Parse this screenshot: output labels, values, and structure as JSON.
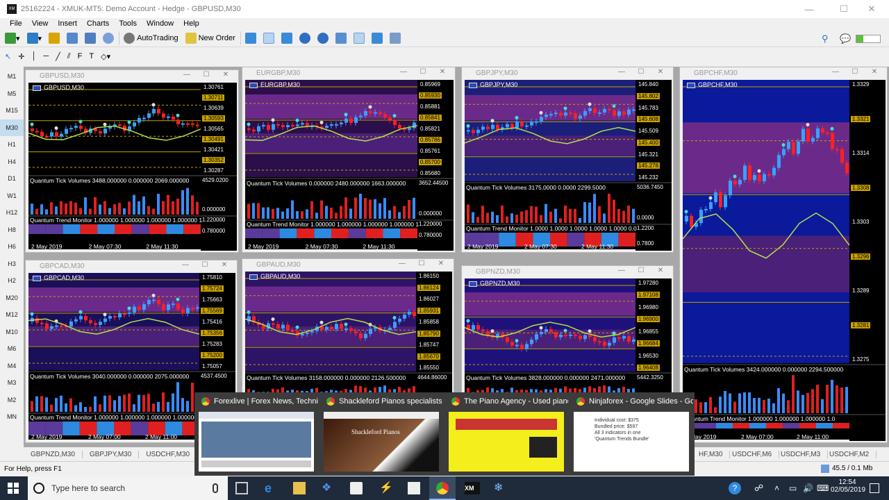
{
  "window": {
    "title": "25162224 - XMUK-MT5: Demo Account - Hedge - GBPUSD,M30",
    "minimize": "—",
    "maximize": "☐",
    "close": "✕"
  },
  "menu": [
    "File",
    "View",
    "Insert",
    "Charts",
    "Tools",
    "Window",
    "Help"
  ],
  "toolbar": {
    "autotrading": "AutoTrading",
    "new_order": "New Order"
  },
  "timeframes": [
    "M1",
    "M5",
    "M15",
    "M30",
    "H1",
    "H4",
    "D1",
    "W1",
    "H12",
    "H8",
    "H6",
    "H3",
    "H2",
    "M20",
    "M12",
    "M10",
    "M6",
    "M4",
    "M3",
    "M2",
    "MN"
  ],
  "active_timeframe": "M30",
  "charts": [
    {
      "win_title": "GBPUSD,M30",
      "inner_title": "GBPUSD,M30",
      "prices": [
        "1.30761",
        "1.30711",
        "1.30639",
        "1.30593",
        "1.30565",
        "1.30491",
        "1.30421",
        "1.30352",
        "1.30287"
      ],
      "volume_label": "Quantum Tick Volumes 3488.000000 0.000000 2069.000000",
      "volume_scale": [
        "4529.0200",
        "0.000000"
      ],
      "trend_label": "Quantum Trend Monitor 1.000000 1.000000 1.000000 1.000000 1",
      "trend_scale": [
        "1.220000",
        "0.780000"
      ],
      "dates": [
        "2 May 2019",
        "2 May 07:30",
        "2 May 11:30"
      ]
    },
    {
      "win_title": "EURGBP,M30",
      "inner_title": "EURGBP,M30",
      "prices": [
        "0.85969",
        "0.85930",
        "0.85881",
        "0.85841",
        "0.85821",
        "0.85786",
        "0.85761",
        "0.85700",
        "0.85680"
      ],
      "volume_label": "Quantum Tick Volumes 0.000000 2480.000000 1663.000000",
      "volume_scale": [
        "3652.44500",
        "0.000000"
      ],
      "trend_label": "Quantum Trend Monitor 1.000000 1.000000 1.000000 1.000000 1",
      "trend_scale": [
        "1.220000",
        "0.780000"
      ],
      "dates": [
        "2 May 2019",
        "2 May 07:30",
        "2 May 11:30"
      ]
    },
    {
      "win_title": "GBPJPY,M30",
      "inner_title": "GBPJPY,M30",
      "prices": [
        "145.840",
        "145.802",
        "145.783",
        "145.608",
        "145.509",
        "145.400",
        "145.321",
        "145.278",
        "145.232"
      ],
      "volume_label": "Quantum Tick Volumes 3175.0000 0.0000 2299.5000",
      "volume_scale": [
        "5036.7450",
        "0.0000"
      ],
      "trend_label": "Quantum Trend Monitor 1.0000 1.0000 1.0000 1.0000 1.0000 0.0",
      "trend_scale": [
        "1.2200",
        "0.7800"
      ],
      "dates": [
        "2 May 2019",
        "2 May 07:30",
        "2 May 11:30"
      ]
    },
    {
      "win_title": "GBPCHF,M30",
      "inner_title": "GBPCHF,M30",
      "prices": [
        "1.3329",
        "1.3321",
        "1.3314",
        "1.3308",
        "1.3303",
        "1.3296",
        "1.3289",
        "1.3281",
        "1.3275"
      ],
      "volume_label": "Quantum Tick Volumes 3424.000000 0.000000 2294.500000",
      "volume_scale": [],
      "trend_label": "Quantum Trend Monitor 1.000000 1.000000 1.000000 1.0",
      "trend_scale": [],
      "dates": [
        "2 May 2019",
        "2 May 07:00",
        "2 May 11:00"
      ]
    },
    {
      "win_title": "GBPCAD,M30",
      "inner_title": "GBPCAD,M30",
      "prices": [
        "1.75810",
        "1.75724",
        "1.75663",
        "1.75569",
        "1.75416",
        "1.75356",
        "1.75283",
        "1.75200",
        "1.75057"
      ],
      "volume_label": "Quantum Tick Volumes 3040.000000 0.000000 2075.000000",
      "volume_scale": [
        "4537.4500"
      ],
      "trend_label": "Quantum Trend Monitor 1.000000 1.000000 1.000000 1.000000",
      "trend_scale": [],
      "dates": [
        "2 May 2019",
        "2 May 07:00",
        "2 May 11:00"
      ]
    },
    {
      "win_title": "GBPAUD,M30",
      "inner_title": "GBPAUD,M30",
      "prices": [
        "1.86150",
        "1.86124",
        "1.86027",
        "1.85931",
        "1.85858",
        "1.85790",
        "1.85747",
        "1.85670",
        "1.85550"
      ],
      "volume_label": "Quantum Tick Volumes 3158.000000 0.000000 2126.500000",
      "volume_scale": [
        "4644.86000"
      ],
      "trend_label": "",
      "trend_scale": [],
      "dates": []
    },
    {
      "win_title": "GBPNZD,M30",
      "inner_title": "GBPNZD,M30",
      "prices": [
        "1.97280",
        "1.97108",
        "1.96980",
        "1.96900",
        "1.96855",
        "1.96684",
        "1.96530",
        "1.96408"
      ],
      "volume_label": "Quantum Tick Volumes 3828.000000 0.000000 2471.000000",
      "volume_scale": [
        "5442.3250"
      ],
      "trend_label": "",
      "trend_scale": [],
      "dates": []
    }
  ],
  "bottom_tabs_left": [
    "GBPNZD,M30",
    "GBPJPY,M30",
    "USDCHF,M30",
    "G"
  ],
  "bottom_tabs_right": [
    "HF,M30",
    "USDCHF,M6",
    "USDCHF,M3",
    "USDCHF,M2"
  ],
  "status": {
    "help": "For Help, press F1",
    "traffic": "45.5 / 0.1 Mb"
  },
  "thumbnails": [
    {
      "title": "Forexlive | Forex News, Technic...",
      "color": "#ffffff"
    },
    {
      "title": "Shackleford Pianos specialists i...",
      "color": "#4a2a1a"
    },
    {
      "title": "The Piano Agency - Used piano...",
      "color": "#f4ee1c"
    },
    {
      "title": "Ninjaforex - Google Slides - Go...",
      "color": "#ffffff"
    }
  ],
  "thumb_texts": {
    "shackleford": "Shackleford Pianos",
    "ninja": [
      "Individual cost: $375",
      "Bundled price: $597",
      "All 3 indicators in one",
      "'Quantum Trends Bundle'"
    ]
  },
  "taskbar": {
    "search_placeholder": "Type here to search",
    "time": "12:54",
    "date": "02/05/2019"
  }
}
